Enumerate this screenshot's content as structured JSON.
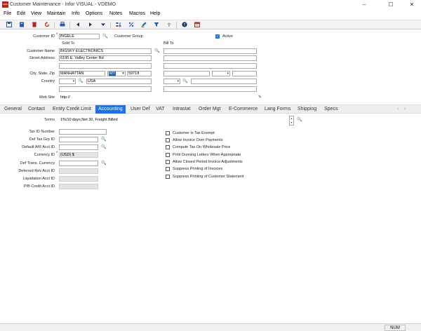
{
  "window": {
    "app_icon_text": "infor",
    "title": "Customer Maintenance - Infor VISUAL - VDEMO",
    "minimize": "–",
    "maximize": "☐",
    "close": "✕"
  },
  "menu": [
    "File",
    "Edit",
    "View",
    "Maintain",
    "Info",
    "Options",
    "Notes",
    "Macros",
    "Help"
  ],
  "toolbar": {
    "icons": [
      "save-icon",
      "new-icon",
      "delete-icon",
      "undo-icon",
      "print-icon",
      "first-icon",
      "prev-icon",
      "next-icon",
      "last-icon",
      "sort-icon",
      "percent-icon",
      "edit-icon",
      "filter-icon",
      "upload-icon",
      "help-icon",
      "calendar-icon"
    ],
    "colors": {
      "blue": "#1a5fb4",
      "red": "#c4201b"
    }
  },
  "header": {
    "customer_id_label": "Customer ID",
    "customer_id": "BIGELE",
    "customer_group_label": "Customer Group",
    "active_label": "Active",
    "sold_to_label": "Sold To",
    "bill_to_label": "Bill To"
  },
  "sold_to": {
    "name_label": "Customer Name",
    "name": "BIGSKY ELECTRONICS",
    "address_label": "Street Address",
    "address": "6195 E. Valley Center Rd",
    "csz_label": "City, State, Zip",
    "city": "MANHATTAN",
    "state": "MT",
    "zip": "59718",
    "country_label": "Country",
    "country": "USA",
    "website_label": "Web Site",
    "website": "http://"
  },
  "tabs": [
    "General",
    "Contact",
    "Entity Credit Limit",
    "Accounting",
    "User Def",
    "VAT",
    "Intrastat",
    "Order Mgt",
    "E-Commerce",
    "Lang Forms",
    "Shipping",
    "Specs"
  ],
  "tab_scroll": {
    "left": "‹",
    "right": "›"
  },
  "accounting": {
    "terms_label": "Terms",
    "terms": "1%/10 days,Net 30, Freight Billed",
    "tax_id_label": "Tax ID Number",
    "def_tax_grp_label": "Def Tax Grp ID",
    "default_ar_label": "Default A/R Acct ID",
    "currency_label": "Currency ID",
    "currency": "(USD) $",
    "def_trans_currency_label": "Def Trans. Currency",
    "deferred_rev_label": "Deferred Rev Acct ID",
    "liquidation_label": "Liquidation Acct ID",
    "pb_credit_label": "P/B Credit Acct ID",
    "checks": [
      "Customer Is Tax Exempt",
      "Allow Invoice Over Payments",
      "Compute Tax On Wholesale Price",
      "Print Dunning Letters When Appropriate",
      "Allow Closed Period Invoice Adjustments",
      "Suppress Printing of Invoices",
      "Suppress Printing of Customer Statement"
    ]
  },
  "status": {
    "num": "NUM"
  }
}
